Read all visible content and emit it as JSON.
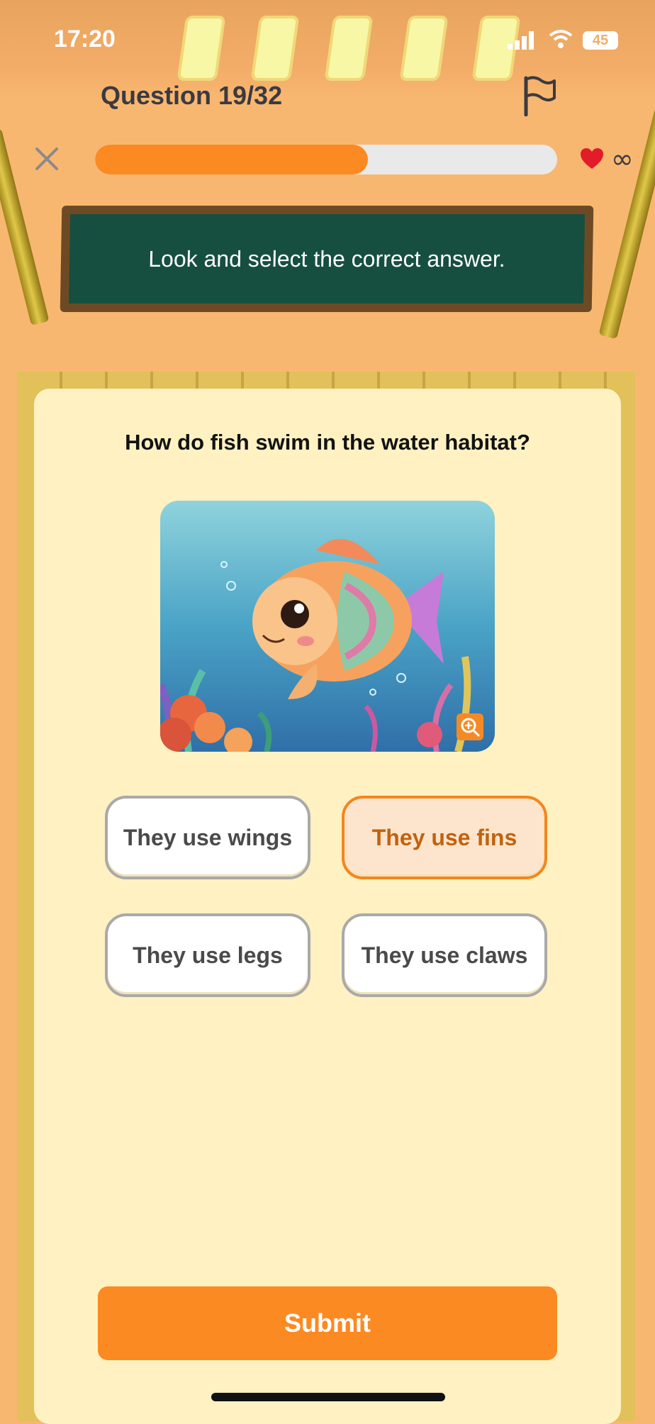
{
  "status_bar": {
    "time": "17:20",
    "battery": "45"
  },
  "header": {
    "question_counter": "Question 19/32",
    "lives": "∞"
  },
  "progress": {
    "current": 19,
    "total": 32,
    "fraction": 0.59
  },
  "instruction": "Look and select the correct answer.",
  "question": "How do fish swim in the water habitat?",
  "options": [
    {
      "label": "They use wings",
      "selected": false
    },
    {
      "label": "They use fins",
      "selected": true
    },
    {
      "label": "They use legs",
      "selected": false
    },
    {
      "label": "They use claws",
      "selected": false
    }
  ],
  "submit_label": "Submit",
  "colors": {
    "accent": "#fb8a22",
    "board": "#164f3f",
    "card": "#fff1c2",
    "background": "#f8b771"
  },
  "icons": [
    "flag-icon",
    "close-icon",
    "heart-icon",
    "zoom-icon",
    "wifi-icon",
    "signal-icon"
  ]
}
